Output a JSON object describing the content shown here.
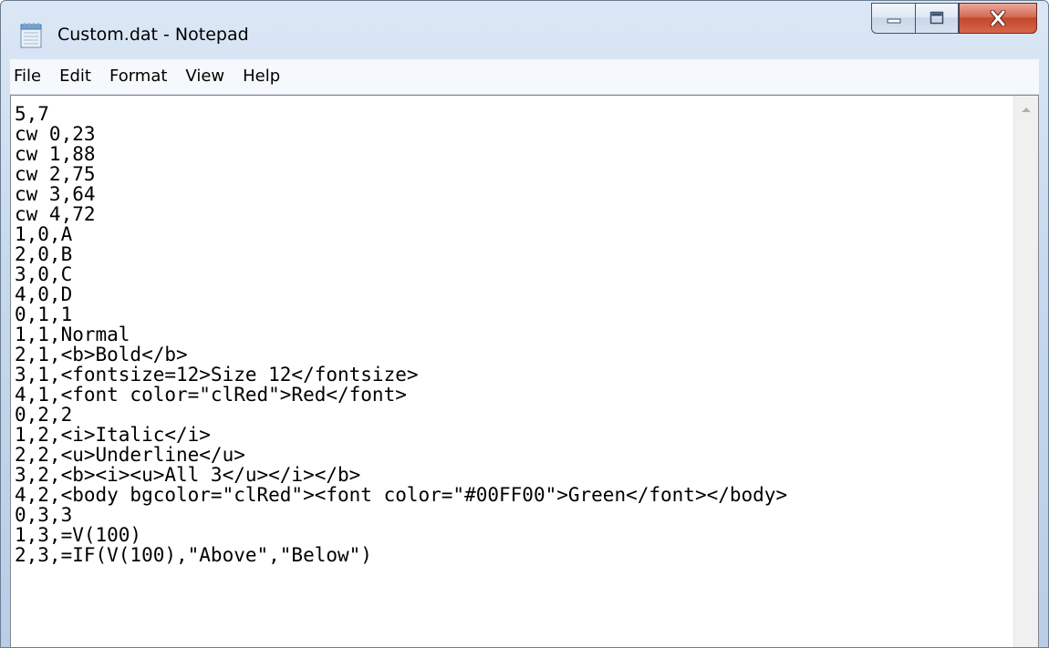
{
  "window": {
    "title": "Custom.dat - Notepad",
    "app_icon": "notepad-icon"
  },
  "caption_buttons": {
    "minimize_icon": "minimize-icon",
    "maximize_icon": "maximize-icon",
    "close_icon": "close-icon"
  },
  "menu": {
    "items": [
      "File",
      "Edit",
      "Format",
      "View",
      "Help"
    ]
  },
  "editor": {
    "lines": [
      "5,7",
      "cw 0,23",
      "cw 1,88",
      "cw 2,75",
      "cw 3,64",
      "cw 4,72",
      "1,0,A",
      "2,0,B",
      "3,0,C",
      "4,0,D",
      "0,1,1",
      "1,1,Normal",
      "2,1,<b>Bold</b>",
      "3,1,<fontsize=12>Size 12</fontsize>",
      "4,1,<font color=\"clRed\">Red</font>",
      "0,2,2",
      "1,2,<i>Italic</i>",
      "2,2,<u>Underline</u>",
      "3,2,<b><i><u>All 3</u></i></b>",
      "4,2,<body bgcolor=\"clRed\"><font color=\"#00FF00\">Green</font></body>",
      "0,3,3",
      "1,3,=V(100)",
      "2,3,=IF(V(100),\"Above\",\"Below\")"
    ]
  },
  "scrollbar": {
    "up_arrow_icon": "scroll-up-arrow-icon"
  },
  "colors": {
    "close_button": "#c2482c",
    "titlebar": "#c8d9ee",
    "editor_background": "#ffffff"
  }
}
